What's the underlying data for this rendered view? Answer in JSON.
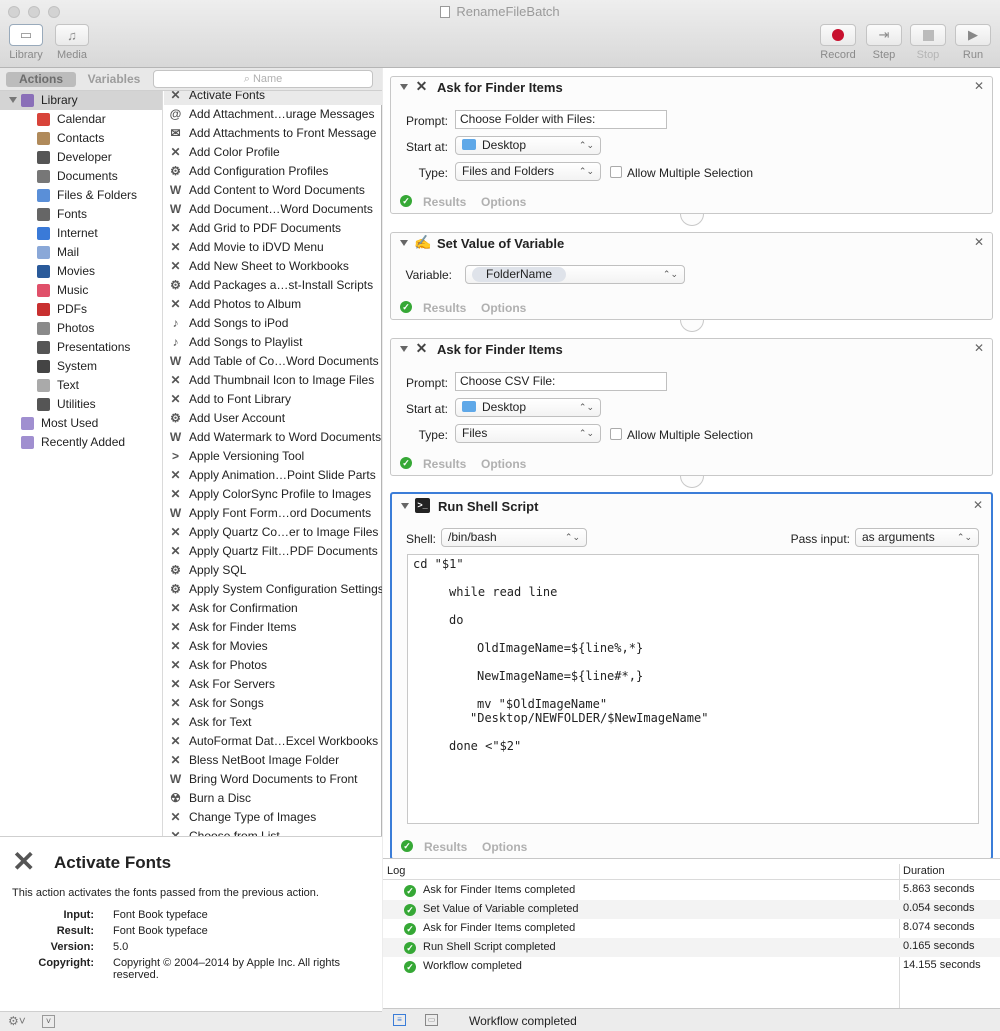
{
  "window": {
    "title": "RenameFileBatch"
  },
  "toolbar": {
    "library": "Library",
    "media": "Media",
    "record": "Record",
    "step": "Step",
    "stop": "Stop",
    "run": "Run"
  },
  "library_pane": {
    "tab_actions": "Actions",
    "tab_variables": "Variables",
    "search_placeholder": "Name",
    "root": "Library",
    "categories": [
      "Calendar",
      "Contacts",
      "Developer",
      "Documents",
      "Files & Folders",
      "Fonts",
      "Internet",
      "Mail",
      "Movies",
      "Music",
      "PDFs",
      "Photos",
      "Presentations",
      "System",
      "Text",
      "Utilities"
    ],
    "extras": [
      "Most Used",
      "Recently Added"
    ]
  },
  "actions": [
    "Activate Fonts",
    "Add Attachment…urage Messages",
    "Add Attachments to Front Message",
    "Add Color Profile",
    "Add Configuration Profiles",
    "Add Content to Word Documents",
    "Add Document…Word Documents",
    "Add Grid to PDF Documents",
    "Add Movie to iDVD Menu",
    "Add New Sheet to Workbooks",
    "Add Packages a…st-Install Scripts",
    "Add Photos to Album",
    "Add Songs to iPod",
    "Add Songs to Playlist",
    "Add Table of Co…Word Documents",
    "Add Thumbnail Icon to Image Files",
    "Add to Font Library",
    "Add User Account",
    "Add Watermark to Word Documents",
    "Apple Versioning Tool",
    "Apply Animation…Point Slide Parts",
    "Apply ColorSync Profile to Images",
    "Apply Font Form…ord Documents",
    "Apply Quartz Co…er to Image Files",
    "Apply Quartz Filt…PDF Documents",
    "Apply SQL",
    "Apply System Configuration Settings",
    "Ask for Confirmation",
    "Ask for Finder Items",
    "Ask for Movies",
    "Ask for Photos",
    "Ask For Servers",
    "Ask for Songs",
    "Ask for Text",
    "AutoFormat Dat…Excel Workbooks",
    "Bless NetBoot Image Folder",
    "Bring Word Documents to Front",
    "Burn a Disc",
    "Change Type of Images",
    "Choose from List"
  ],
  "action_icons": [
    "✕",
    "@",
    "✉",
    "✕",
    "⚙",
    "W",
    "W",
    "✕",
    "✕",
    "✕",
    "⚙",
    "✕",
    "♪",
    "♪",
    "W",
    "✕",
    "✕",
    "⚙",
    "W",
    ">",
    "✕",
    "✕",
    "W",
    "✕",
    "✕",
    "⚙",
    "⚙",
    "✕",
    "✕",
    "✕",
    "✕",
    "✕",
    "✕",
    "✕",
    "✕",
    "✕",
    "W",
    "☢",
    "✕",
    "✕"
  ],
  "description": {
    "title": "Activate Fonts",
    "summary": "This action activates the fonts passed from the previous action.",
    "input_label": "Input:",
    "input": "Font Book typeface",
    "result_label": "Result:",
    "result": "Font Book typeface",
    "version_label": "Version:",
    "version": "5.0",
    "copyright_label": "Copyright:",
    "copyright": "Copyright © 2004–2014 by Apple Inc. All rights reserved."
  },
  "workflow": {
    "card1": {
      "title": "Ask for Finder Items",
      "prompt_label": "Prompt:",
      "prompt": "Choose Folder with Files:",
      "start_label": "Start at:",
      "start": "Desktop",
      "type_label": "Type:",
      "type": "Files and Folders",
      "allow_multi": "Allow Multiple Selection",
      "results": "Results",
      "options": "Options"
    },
    "card2": {
      "title": "Set Value of Variable",
      "variable_label": "Variable:",
      "variable": "FolderName",
      "results": "Results",
      "options": "Options"
    },
    "card3": {
      "title": "Ask for Finder Items",
      "prompt_label": "Prompt:",
      "prompt": "Choose CSV File:",
      "start_label": "Start at:",
      "start": "Desktop",
      "type_label": "Type:",
      "type": "Files",
      "allow_multi": "Allow Multiple Selection",
      "results": "Results",
      "options": "Options"
    },
    "card4": {
      "title": "Run Shell Script",
      "shell_label": "Shell:",
      "shell": "/bin/bash",
      "pass_label": "Pass input:",
      "pass": "as arguments",
      "code": [
        "cd \"$1\"",
        "while read line",
        "do",
        "OldImageName=${line%,*}",
        "NewImageName=${line#*,}",
        "mv \"$OldImageName\"",
        "\"Desktop/NEWFOLDER/$NewImageName\"",
        "done <\"$2\""
      ],
      "results": "Results",
      "options": "Options"
    }
  },
  "log": {
    "col_log": "Log",
    "col_duration": "Duration",
    "rows": [
      {
        "text": "Ask for Finder Items completed",
        "duration": "5.863 seconds"
      },
      {
        "text": "Set Value of Variable completed",
        "duration": "0.054 seconds"
      },
      {
        "text": "Ask for Finder Items completed",
        "duration": "8.074 seconds"
      },
      {
        "text": "Run Shell Script completed",
        "duration": "0.165 seconds"
      },
      {
        "text": "Workflow completed",
        "duration": "14.155 seconds"
      }
    ]
  },
  "status": {
    "text": "Workflow completed"
  }
}
